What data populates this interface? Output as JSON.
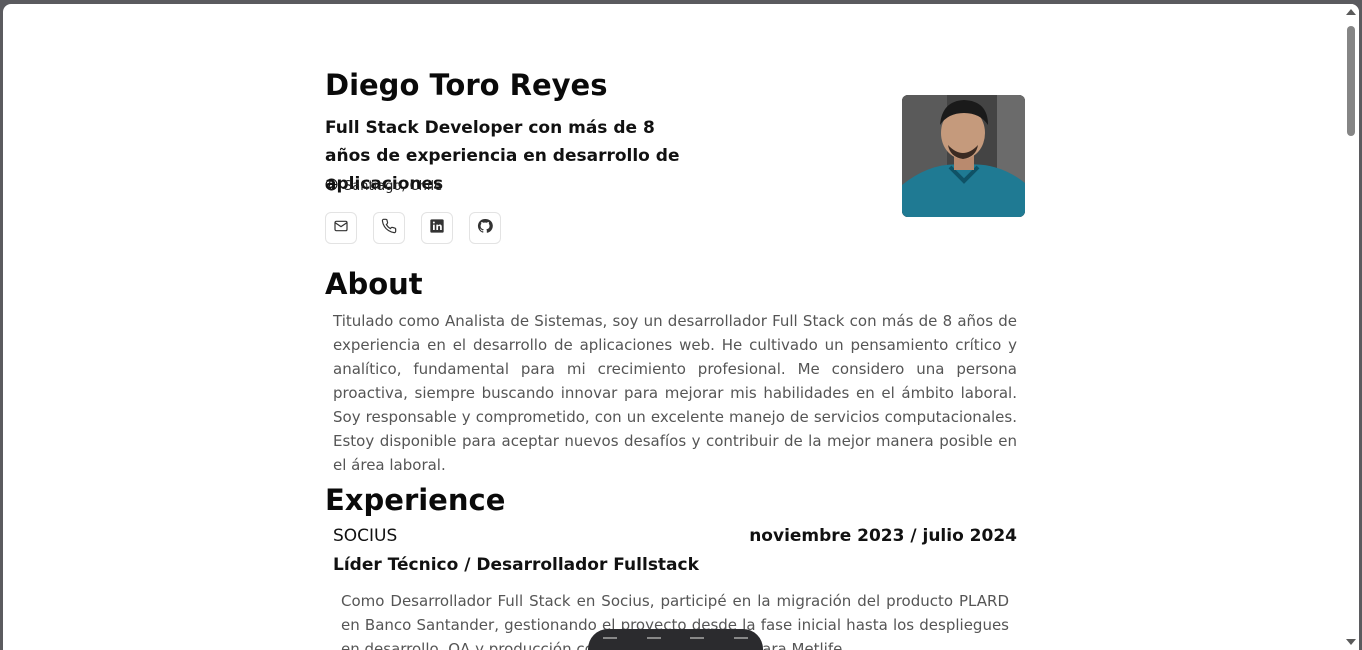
{
  "profile": {
    "name": "Diego Toro Reyes",
    "subtitle": "Full Stack Developer con más de 8 años de experiencia en desarrollo de aplicaciones",
    "location": "Santiago, Chile",
    "contacts": [
      "mail-icon",
      "phone-icon",
      "linkedin-icon",
      "github-icon"
    ]
  },
  "about": {
    "title": "About",
    "text": "Titulado como Analista de Sistemas, soy un desarrollador Full Stack con más de 8 años de experiencia en el desarrollo de aplicaciones web. He cultivado un pensamiento crítico y analítico, fundamental para mi crecimiento profesional. Me considero una persona proactiva, siempre buscando innovar para mejorar mis habilidades en el ámbito laboral. Soy responsable y comprometido, con un excelente manejo de servicios computacionales. Estoy disponible para aceptar nuevos desafíos y contribuir de la mejor manera posible en el área laboral."
  },
  "experience": {
    "title": "Experience",
    "jobs": [
      {
        "company": "SOCIUS",
        "dates": "noviembre 2023 / julio 2024",
        "role": "Líder Técnico / Desarrollador Fullstack",
        "description": "Como Desarrollador Full Stack en Socius, participé en la migración del producto PLARD en Banco Santander, gestionando el proyecto desde la fase inicial hasta los despliegues en desarrollo, QA y producción con ... lideré proyectos para Metlife"
      }
    ]
  },
  "colors": {
    "background": "#ffffff",
    "text_primary": "#0a0a0a",
    "text_muted": "#555555",
    "frame": "#5b5b5f"
  }
}
